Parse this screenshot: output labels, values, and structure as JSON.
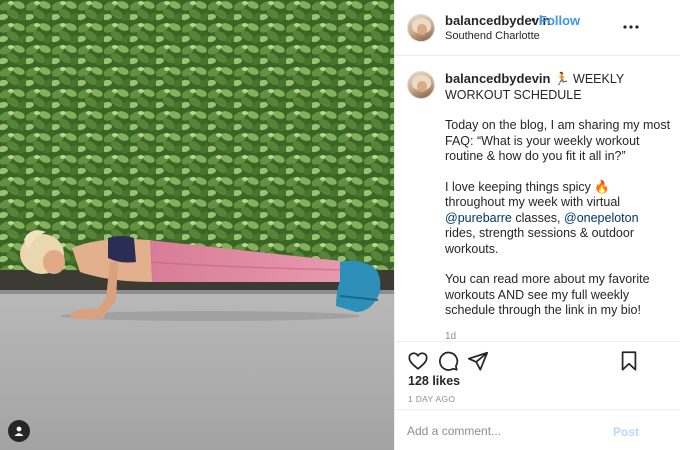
{
  "post": {
    "username": "balancedbydevin",
    "follow_label": "Follow",
    "separator": "•",
    "location": "Southend Charlotte",
    "caption": {
      "headline_emoji": "🏃",
      "headline_text": "WEEKLY WORKOUT SCHEDULE",
      "paragraph1": "Today on the blog, I am sharing my most FAQ: “What is your weekly workout routine & how do you fit it all in?”",
      "paragraph2_a": "I love keeping things spicy 🔥 throughout my week with virtual ",
      "mention1": "@purebarre",
      "paragraph2_b": " classes, ",
      "mention2": "@onepeloton",
      "paragraph2_c": " rides, strength sessions & outdoor workouts.",
      "paragraph3": "You can read more about my favorite workouts AND see my full weekly schedule through the link in my bio!",
      "age": "1d"
    },
    "likes": "128 likes",
    "timestamp": "1 DAY AGO",
    "comment": {
      "placeholder": "Add a comment...",
      "value": "",
      "post_label": "Post"
    }
  },
  "icons": [
    "more-options-icon",
    "heart-icon",
    "comment-icon",
    "share-icon",
    "bookmark-icon",
    "user-tag-icon"
  ],
  "colors": {
    "link_blue": "#3897f0",
    "mention_blue": "#00376b",
    "post_disabled": "#b3dbff",
    "text": "#262626",
    "muted": "#8e8e8e",
    "divider": "#efefef"
  }
}
